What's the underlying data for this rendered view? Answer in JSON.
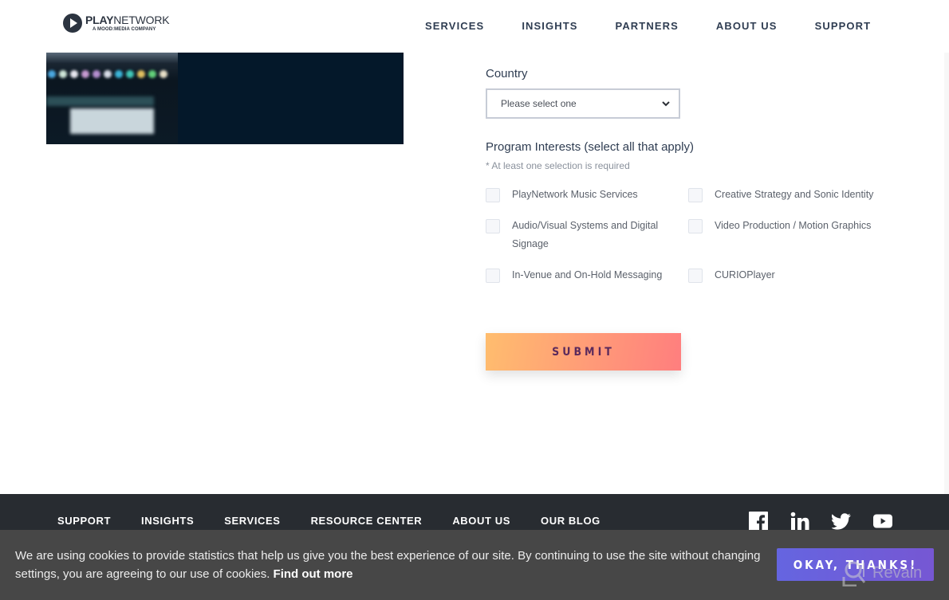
{
  "header": {
    "logo": {
      "name_bold": "PLAY",
      "name_light": "NETWORK",
      "tagline": "A MOOD:MEDIA COMPANY"
    },
    "nav": [
      {
        "label": "SERVICES"
      },
      {
        "label": "INSIGHTS"
      },
      {
        "label": "PARTNERS"
      },
      {
        "label": "ABOUT US"
      },
      {
        "label": "SUPPORT"
      }
    ]
  },
  "form": {
    "country_label": "Country",
    "country_select": {
      "value": "Please select one"
    },
    "interests_label": "Program Interests (select all that apply)",
    "interests_note": "* At least one selection is required",
    "options": [
      {
        "label": "PlayNetwork Music Services",
        "checked": false
      },
      {
        "label": "Creative Strategy and Sonic Identity",
        "checked": false
      },
      {
        "label": "Audio/Visual Systems and Digital Signage",
        "checked": false
      },
      {
        "label": "Video Production / Motion Graphics",
        "checked": false
      },
      {
        "label": "In-Venue and On-Hold Messaging",
        "checked": false
      },
      {
        "label": "CURIOPlayer",
        "checked": false
      }
    ],
    "submit_label": "SUBMIT"
  },
  "footer": {
    "nav": [
      {
        "label": "SUPPORT"
      },
      {
        "label": "INSIGHTS"
      },
      {
        "label": "SERVICES"
      },
      {
        "label": "RESOURCE CENTER"
      },
      {
        "label": "ABOUT US"
      },
      {
        "label": "OUR BLOG"
      }
    ],
    "social": [
      "facebook-icon",
      "linkedin-icon",
      "twitter-icon",
      "youtube-icon"
    ]
  },
  "cookie_bar": {
    "text": "We are using cookies to provide statistics that help us give you the best experience of our site. By continuing to use the site without changing settings, you are agreeing to our use of cookies.",
    "link_label": "Find out more",
    "accept_label": "OKAY, THANKS!"
  },
  "watermark": {
    "text": "Revain"
  },
  "colors": {
    "nav_text": "#2f3d52",
    "footer_bg": "#282c31",
    "cookie_bg": "#474747",
    "submit_gradient_start": "#ffbd6e",
    "submit_gradient_end": "#ff7e7e",
    "accept_button": "#6565e0"
  }
}
